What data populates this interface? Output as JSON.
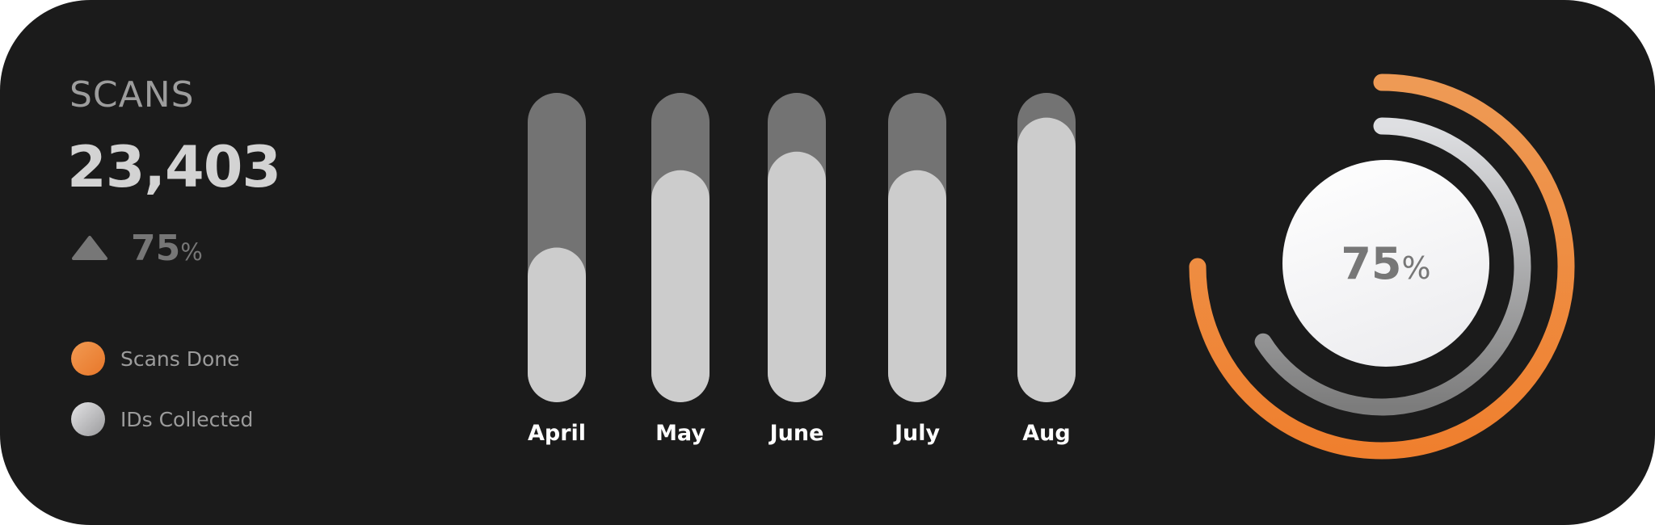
{
  "summary": {
    "title": "SCANS",
    "total": "23,403",
    "change_value": "75",
    "change_unit": "%",
    "change_direction": "up"
  },
  "legend": [
    {
      "label": "Scans Done",
      "color": "#ed8a3c"
    },
    {
      "label": "IDs Collected",
      "color": "#c9c9c9"
    }
  ],
  "chart_data": {
    "type": "bar",
    "categories": [
      "April",
      "May",
      "June",
      "July",
      "Aug"
    ],
    "values": [
      0.5,
      0.75,
      0.81,
      0.75,
      0.92
    ],
    "max": 1.0
  },
  "radial": {
    "value": "75",
    "unit": "%",
    "outer_fraction": 0.75,
    "inner_fraction": 0.66,
    "outer_colors": [
      "#ef7f2e",
      "#ee9a55"
    ],
    "inner_colors": [
      "#dedfe2",
      "#7c7c7c"
    ]
  },
  "colors": {
    "background": "#1b1b1b",
    "bar_track": "#737373",
    "bar_fill": "#cccccc",
    "accent": "#ef7f2e"
  }
}
